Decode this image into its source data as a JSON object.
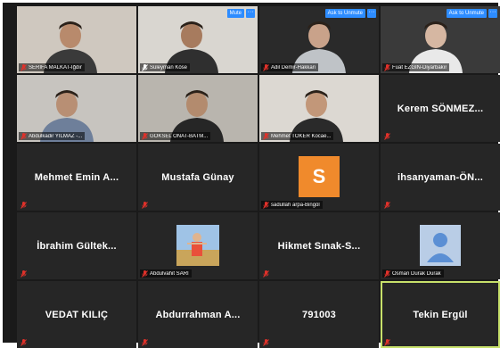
{
  "colors": {
    "accent": "#2d8cff",
    "active_speaker": "#c7e06a",
    "muted_mic": "#e0312a",
    "avatar_orange": "#f08a2c"
  },
  "tiles": [
    {
      "label": "SERİFA MALKAT-İğdır",
      "type": "video",
      "muted": true
    },
    {
      "label": "Süleyman Köse",
      "type": "video",
      "muted": false,
      "top_button": "Mute"
    },
    {
      "label": "Adil Demir-Hakkari",
      "type": "video",
      "muted": true,
      "top_button": "Ask to Unmute"
    },
    {
      "label": "Fuat EZGİN-Diyarbakır",
      "type": "video",
      "muted": true,
      "top_button": "Ask to Unmute"
    },
    {
      "label": "Abdulkadir YILMAZ -...",
      "type": "video",
      "muted": true
    },
    {
      "label": "GÖKSEL ONAT-BATM...",
      "type": "video",
      "muted": true
    },
    {
      "label": "Mehmet TOKER Kocae...",
      "type": "video",
      "muted": true
    },
    {
      "center": "Kerem  SÖNMEZ...",
      "label": "",
      "type": "name",
      "muted": true
    },
    {
      "center": "Mehmet  Emin  A...",
      "label": "",
      "type": "name",
      "muted": true
    },
    {
      "center": "Mustafa Günay",
      "label": "",
      "type": "name",
      "muted": true
    },
    {
      "label": "sadullah arpa-Bingöl",
      "type": "avatar",
      "avatar_letter": "S",
      "muted": true
    },
    {
      "center": "ihsanyaman-ÖN...",
      "label": "",
      "type": "name",
      "muted": true
    },
    {
      "center": "İbrahim  Gültek...",
      "label": "",
      "type": "name",
      "muted": true
    },
    {
      "label": "Abdulvahit SARI",
      "type": "photo",
      "muted": true
    },
    {
      "center": "Hikmet  Sınak-S...",
      "label": "",
      "type": "name",
      "muted": true
    },
    {
      "label": "Osman Durak Durak",
      "type": "generic-avatar",
      "muted": true
    },
    {
      "center": "VEDAT KILIÇ",
      "label": "",
      "type": "name",
      "muted": true
    },
    {
      "center": "Abdurrahman  A...",
      "label": "",
      "type": "name",
      "muted": true
    },
    {
      "center": "791003",
      "label": "",
      "type": "name",
      "muted": true
    },
    {
      "center": "Tekin Ergül",
      "label": "",
      "type": "name",
      "muted": true,
      "active": true
    }
  ]
}
